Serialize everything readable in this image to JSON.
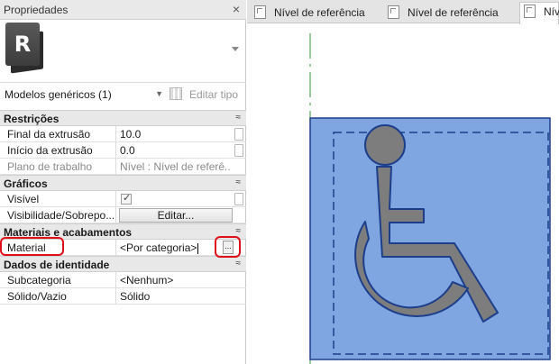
{
  "panel": {
    "title": "Propriedades",
    "close_glyph": "×",
    "logo_letter": "R",
    "family_value": "Modelos genéricos (1)",
    "edit_type_label": "Editar tipo"
  },
  "groups": {
    "restricoes": "Restrições",
    "graficos": "Gráficos",
    "materiais": "Materiais e acabamentos",
    "identidade": "Dados de identidade"
  },
  "params": {
    "final_extrusao": {
      "label": "Final da extrusão",
      "value": "10.0"
    },
    "inicio_extrusao": {
      "label": "Início da extrusão",
      "value": "0.0"
    },
    "plano_trabalho": {
      "label": "Plano de trabalho",
      "value": "Nível : Nível de referê..."
    },
    "visivel": {
      "label": "Visível",
      "checked": true
    },
    "visibilidade": {
      "label": "Visibilidade/Sobrepo...",
      "button": "Editar..."
    },
    "material": {
      "label": "Material",
      "value": "<Por categoria>",
      "browse": "..."
    },
    "subcategoria": {
      "label": "Subcategoria",
      "value": "<Nenhum>"
    },
    "solido_vazio": {
      "label": "Sólido/Vazio",
      "value": "Sólido"
    }
  },
  "tabs": [
    {
      "label": "Nível de referência"
    },
    {
      "label": "Nível de referência"
    },
    {
      "label": "Nív"
    }
  ],
  "colors": {
    "highlight": "#e0101a",
    "symbol_fill": "#7fa6e0",
    "symbol_edge": "#1d3e8a",
    "figure": "#7d7d7d",
    "ref_line": "#2e9a3a"
  },
  "icons": [
    "revit-logo-icon",
    "close-icon",
    "chevron-down-icon",
    "edit-type-icon",
    "collapse-icon",
    "checkbox-icon",
    "view-tab-icon",
    "wheelchair-accessibility-symbol"
  ]
}
